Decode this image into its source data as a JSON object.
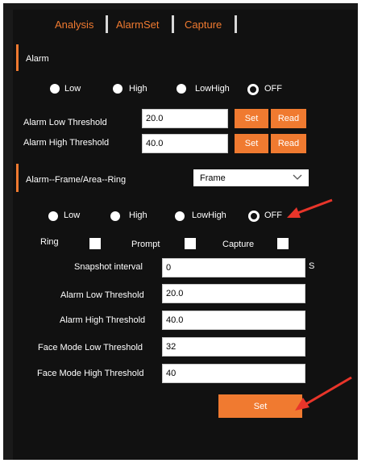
{
  "tabs": [
    "Analysis",
    "AlarmSet",
    "Capture"
  ],
  "alarm_section": {
    "title": "Alarm",
    "radios": [
      "Low",
      "High",
      "LowHigh",
      "OFF"
    ],
    "selected": "OFF",
    "low_label": "Alarm Low Threshold",
    "low_value": "20.0",
    "high_label": "Alarm High Threshold",
    "high_value": "40.0",
    "set_label": "Set",
    "read_label": "Read"
  },
  "ring_section": {
    "title": "Alarm--Frame/Area--Ring",
    "mode_value": "Frame",
    "radios": [
      "Low",
      "High",
      "LowHigh",
      "OFF"
    ],
    "selected": "OFF",
    "ring_label": "Ring",
    "prompt_label": "Prompt",
    "capture_label": "Capture",
    "snapshot_label": "Snapshot interval",
    "snapshot_value": "0",
    "snapshot_unit": "S",
    "low_label": "Alarm Low Threshold",
    "low_value": "20.0",
    "high_label": "Alarm High Threshold",
    "high_value": "40.0",
    "face_low_label": "Face Mode Low Threshold",
    "face_low_value": "32",
    "face_high_label": "Face Mode High Threshold",
    "face_high_value": "40",
    "set_label": "Set"
  },
  "colors": {
    "accent": "#f07a30",
    "background": "#111111",
    "annotation_arrow": "#e8352a"
  }
}
